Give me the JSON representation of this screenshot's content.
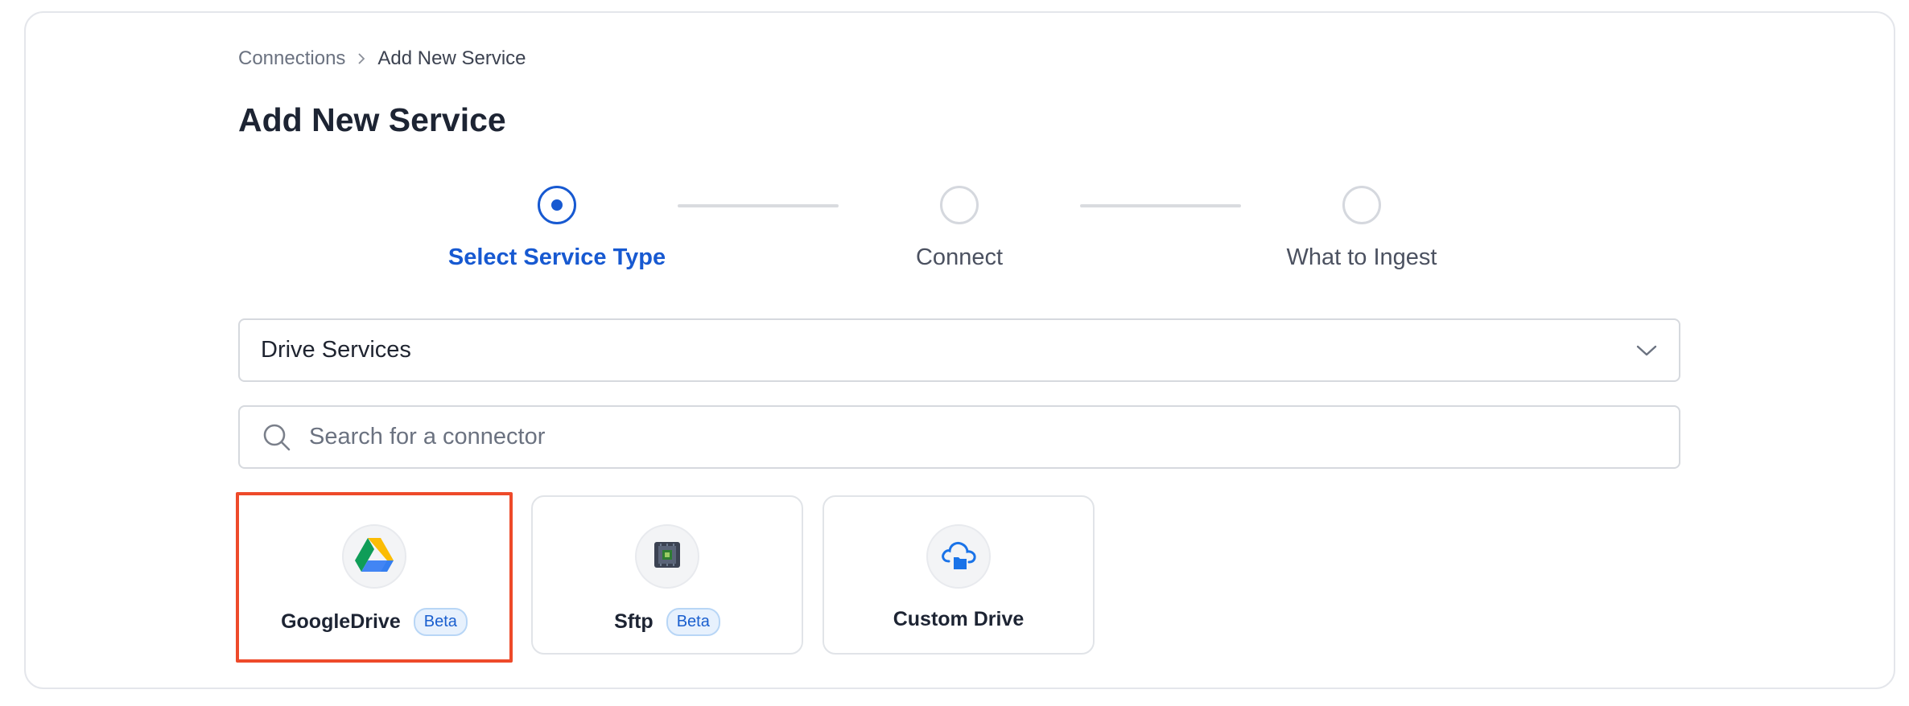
{
  "breadcrumb": {
    "parent": "Connections",
    "current": "Add New Service"
  },
  "page": {
    "title": "Add New Service"
  },
  "stepper": {
    "steps": [
      {
        "label": "Select Service Type",
        "state": "active"
      },
      {
        "label": "Connect",
        "state": "pending"
      },
      {
        "label": "What to Ingest",
        "state": "pending"
      }
    ]
  },
  "service_category": {
    "selected": "Drive Services",
    "icon": "chevron-down-icon"
  },
  "search": {
    "placeholder": "Search for a connector",
    "value": "",
    "icon": "search-icon"
  },
  "connectors": [
    {
      "name": "GoogleDrive",
      "badge": "Beta",
      "icon": "google-drive-icon",
      "selected": true
    },
    {
      "name": "Sftp",
      "badge": "Beta",
      "icon": "sftp-chip-icon",
      "selected": false
    },
    {
      "name": "Custom Drive",
      "badge": "",
      "icon": "cloud-folder-icon",
      "selected": false
    }
  ],
  "colors": {
    "accent": "#1759d1",
    "selection_outline": "#ee4a2a",
    "badge_bg": "#e7f1fd",
    "badge_text": "#1a5fcf"
  }
}
